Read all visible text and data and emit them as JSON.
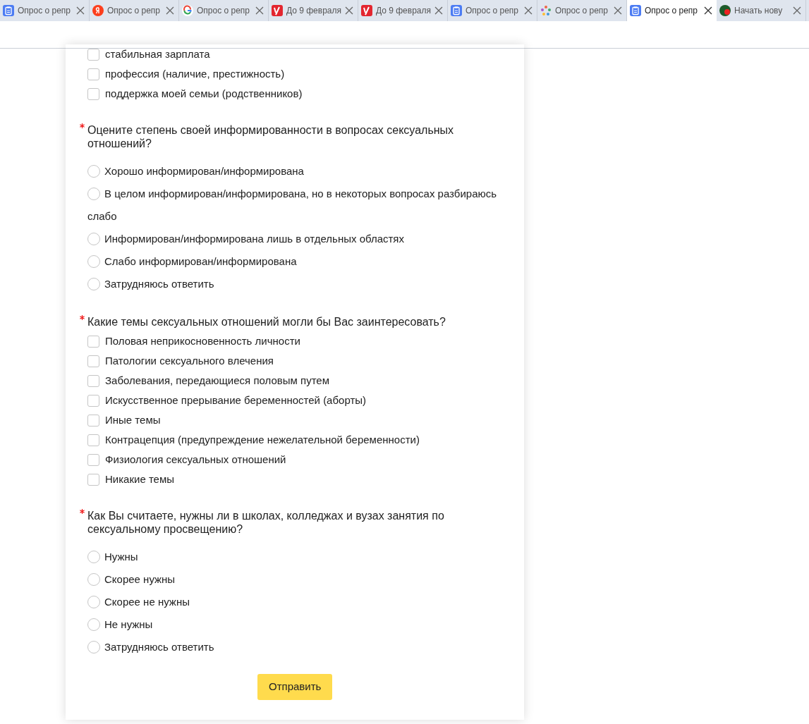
{
  "tabs": [
    {
      "kind": "form",
      "title": "Опрос о репр",
      "selected": false
    },
    {
      "kind": "ya",
      "title": "Опрос о репр",
      "selected": false
    },
    {
      "kind": "g",
      "title": "Опрос о репр",
      "selected": false
    },
    {
      "kind": "u",
      "title": "До 9 февраля",
      "selected": false
    },
    {
      "kind": "u",
      "title": "До 9 февраля",
      "selected": false
    },
    {
      "kind": "form",
      "title": "Опрос о репр",
      "selected": false
    },
    {
      "kind": "flower",
      "title": "Опрос о репр",
      "selected": false
    },
    {
      "kind": "form",
      "title": "Опрос о репр",
      "selected": true
    },
    {
      "kind": "s",
      "title": "Начать нову",
      "selected": false
    }
  ],
  "questions": [
    {
      "kind": "checkbox",
      "options": [
        {
          "label": "стабильная зарплата",
          "checked": false
        },
        {
          "label": "профессия (наличие, престижность)",
          "checked": false
        },
        {
          "label": "поддержка моей семьи (родственников)",
          "checked": false
        }
      ]
    },
    {
      "kind": "radio",
      "required": true,
      "text": "Оцените степень своей информированности в вопросах сексуальных отношений?",
      "options": [
        {
          "label": "Хорошо информирован/информирована",
          "selected": false
        },
        {
          "label": "В целом информирован/информирована, но в некоторых вопросах разбираюсь слабо",
          "selected": false
        },
        {
          "label": "Информирован/информирована лишь в отдельных областях",
          "selected": false
        },
        {
          "label": "Слабо информирован/информирована",
          "selected": false
        },
        {
          "label": "Затрудняюсь ответить",
          "selected": false
        }
      ]
    },
    {
      "kind": "checkbox",
      "required": true,
      "text": "Какие темы сексуальных отношений могли бы Вас заинтересовать?",
      "options": [
        {
          "label": "Половая неприкосновенность личности",
          "checked": false
        },
        {
          "label": "Патологии сексуального влечения",
          "checked": false
        },
        {
          "label": "Заболевания, передающиеся половым путем",
          "checked": false
        },
        {
          "label": "Искусственное прерывание беременностей (аборты)",
          "checked": false
        },
        {
          "label": "Иные темы",
          "checked": false
        },
        {
          "label": "Контрацепция (предупреждение нежелательной беременности)",
          "checked": false
        },
        {
          "label": "Физиология сексуальных отношений",
          "checked": false
        },
        {
          "label": "Никакие темы",
          "checked": false
        }
      ]
    },
    {
      "kind": "radio",
      "required": true,
      "text": "Как Вы считаете, нужны ли в школах, колледжах и вузах занятия по сексуальному просвещению?",
      "options": [
        {
          "label": "Нужны",
          "selected": false
        },
        {
          "label": "Скорее нужны",
          "selected": false
        },
        {
          "label": "Скорее не нужны",
          "selected": false
        },
        {
          "label": "Не нужны",
          "selected": false
        },
        {
          "label": "Затрудняюсь ответить",
          "selected": false
        }
      ]
    }
  ],
  "submit": "Отправить"
}
